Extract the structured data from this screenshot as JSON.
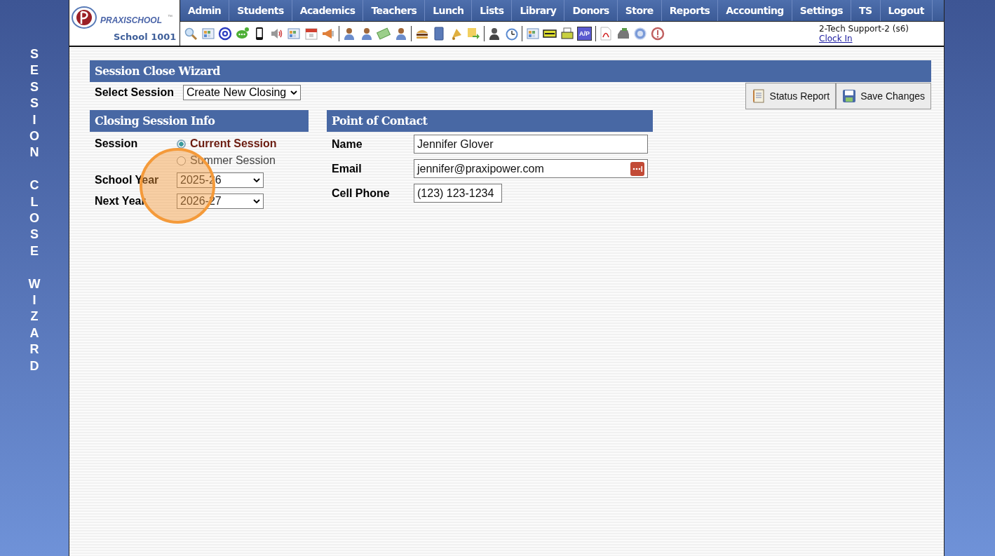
{
  "sidebar": {
    "title": "SESSION CLOSE WIZARD"
  },
  "logo": {
    "brand": "PRAXISCHOOL",
    "mark": "™",
    "school": "School 1001"
  },
  "nav": [
    "Admin",
    "Students",
    "Academics",
    "Teachers",
    "Lunch",
    "Lists",
    "Library",
    "Donors",
    "Store",
    "Reports",
    "Accounting",
    "Settings",
    "TS",
    "Logout"
  ],
  "toolbar": {
    "ap_label": "A/P"
  },
  "user": {
    "name": "2-Tech Support-2 (s6)",
    "clock_in": "Clock In"
  },
  "wizard": {
    "title": "Session Close Wizard",
    "select_label": "Select Session",
    "select_value": "Create New Closing"
  },
  "buttons": [
    "Status Report",
    "Save Changes"
  ],
  "closing_info": {
    "title": "Closing Session Info",
    "session_label": "Session",
    "options": [
      {
        "label": "Current Session",
        "selected": true
      },
      {
        "label": "Summer Session",
        "selected": false
      }
    ],
    "school_year": {
      "label": "School Year",
      "value": "2025-26"
    },
    "next_year": {
      "label": "Next Year",
      "value": "2026-27"
    }
  },
  "contact": {
    "title": "Point of Contact",
    "fields": [
      {
        "label": "Name",
        "value": "Jennifer Glover",
        "kind": "wide"
      },
      {
        "label": "Email",
        "value": "jennifer@praxipower.com",
        "kind": "email"
      },
      {
        "label": "Cell Phone",
        "value": "(123) 123-1234",
        "kind": "short"
      }
    ]
  }
}
